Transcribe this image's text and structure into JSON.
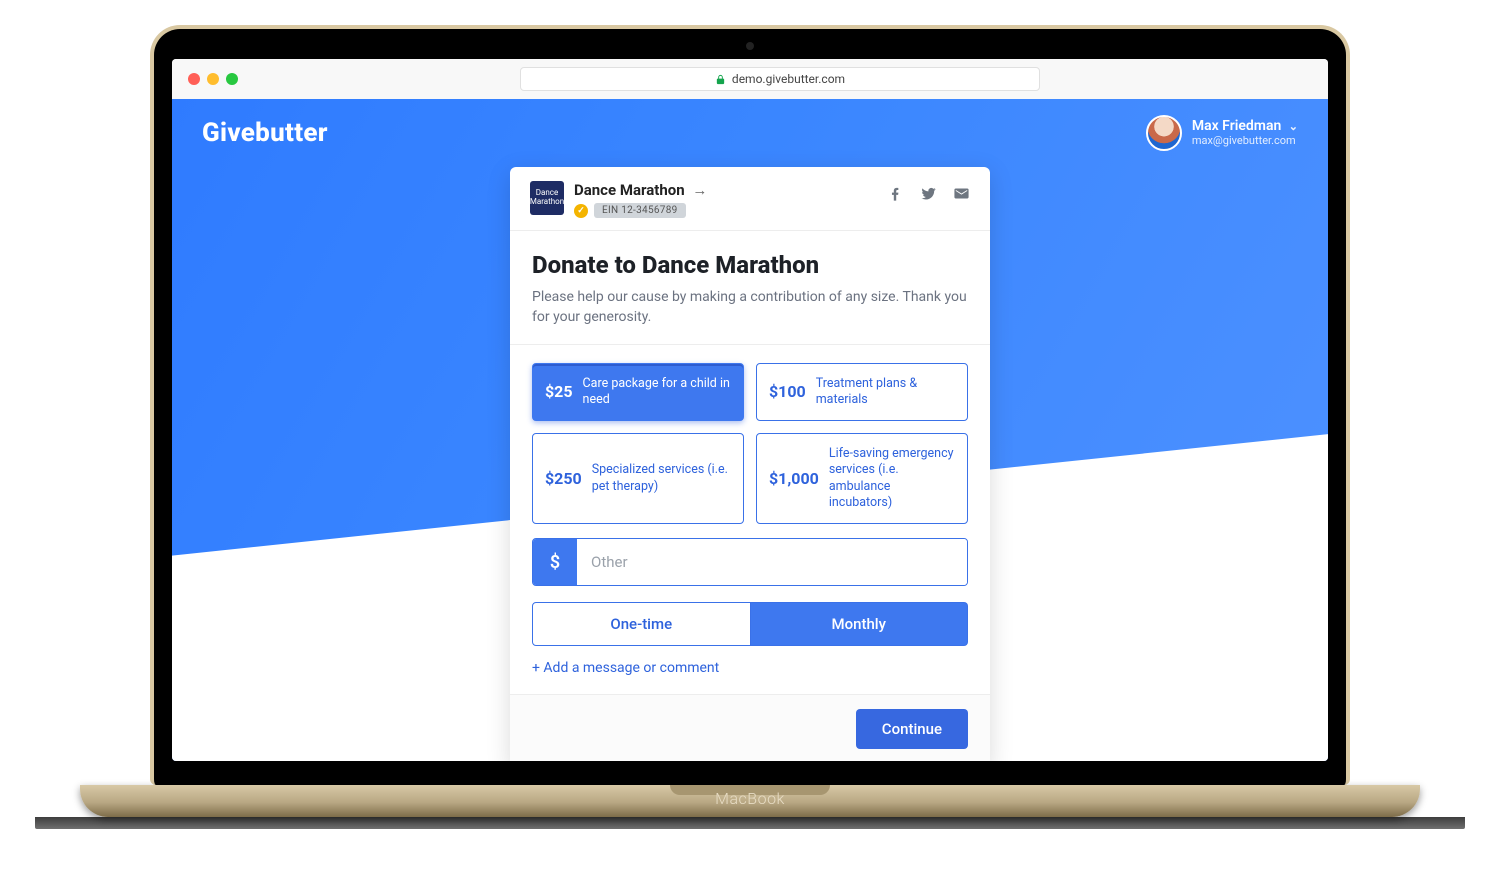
{
  "browser": {
    "url": "demo.givebutter.com"
  },
  "device_label": "MacBook",
  "header": {
    "brand": "Givebutter",
    "user": {
      "name": "Max Friedman",
      "email": "max@givebutter.com"
    }
  },
  "campaign": {
    "logo_text": "Dance Marathon",
    "name": "Dance Marathon",
    "ein": "EIN 12-3456789"
  },
  "form": {
    "title": "Donate to Dance Marathon",
    "subtitle": "Please help our cause by making a contribution of any size. Thank you for your generosity.",
    "options": [
      {
        "amount": "$25",
        "desc": "Care package for a child in need",
        "selected": true
      },
      {
        "amount": "$100",
        "desc": "Treatment plans & materials",
        "selected": false
      },
      {
        "amount": "$250",
        "desc": "Specialized services (i.e. pet therapy)",
        "selected": false
      },
      {
        "amount": "$1,000",
        "desc": "Life-saving emergency services (i.e. ambulance incubators)",
        "selected": false
      }
    ],
    "other": {
      "symbol": "$",
      "placeholder": "Other"
    },
    "frequency": {
      "one_time": "One-time",
      "monthly": "Monthly",
      "active": "monthly"
    },
    "add_message": "+ Add a message or comment",
    "continue": "Continue"
  }
}
